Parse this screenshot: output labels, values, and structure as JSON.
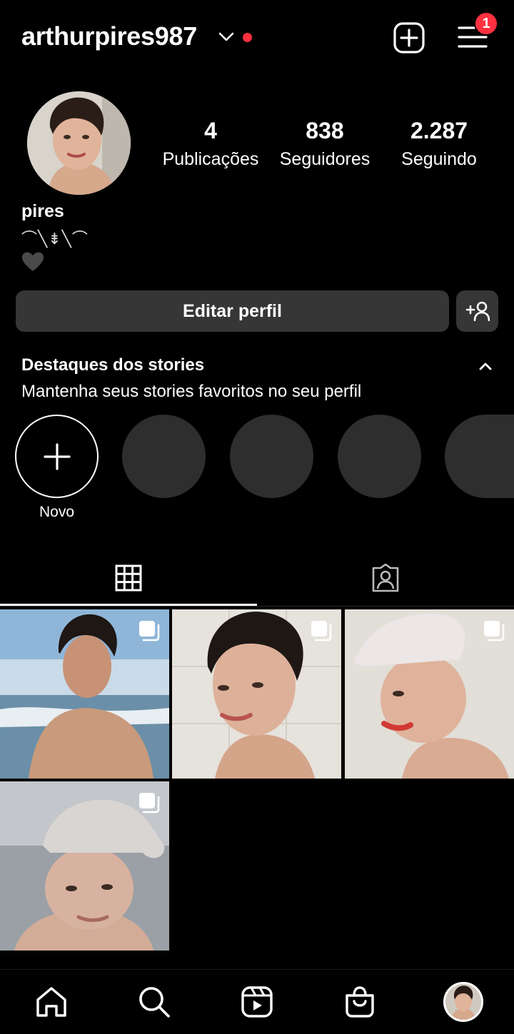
{
  "header": {
    "username": "arthurpires987",
    "notification_count": "1"
  },
  "profile": {
    "stats": [
      {
        "value": "4",
        "label": "Publicações"
      },
      {
        "value": "838",
        "label": "Seguidores"
      },
      {
        "value": "2.287",
        "label": "Seguindo"
      }
    ],
    "display_name": "pires",
    "bio_line": "⌒╲⇟╲⌒"
  },
  "actions": {
    "edit_profile": "Editar perfil"
  },
  "highlights": {
    "title": "Destaques dos stories",
    "subtitle": "Mantenha seus stories favoritos no seu perfil",
    "new_label": "Novo"
  },
  "tabs": [
    "grid-icon",
    "tagged-icon"
  ],
  "posts": [
    {
      "description": "beach",
      "multi": true
    },
    {
      "description": "bathroom",
      "multi": true
    },
    {
      "description": "white-cap",
      "multi": true
    },
    {
      "description": "beach-cap",
      "multi": true
    }
  ],
  "bottom_nav": [
    "home-icon",
    "search-icon",
    "reels-icon",
    "shop-icon",
    "profile-avatar"
  ],
  "colors": {
    "background": "#000000",
    "button": "#363636",
    "highlight_placeholder": "#2e2e2e",
    "notification_red": "#ff3040"
  }
}
